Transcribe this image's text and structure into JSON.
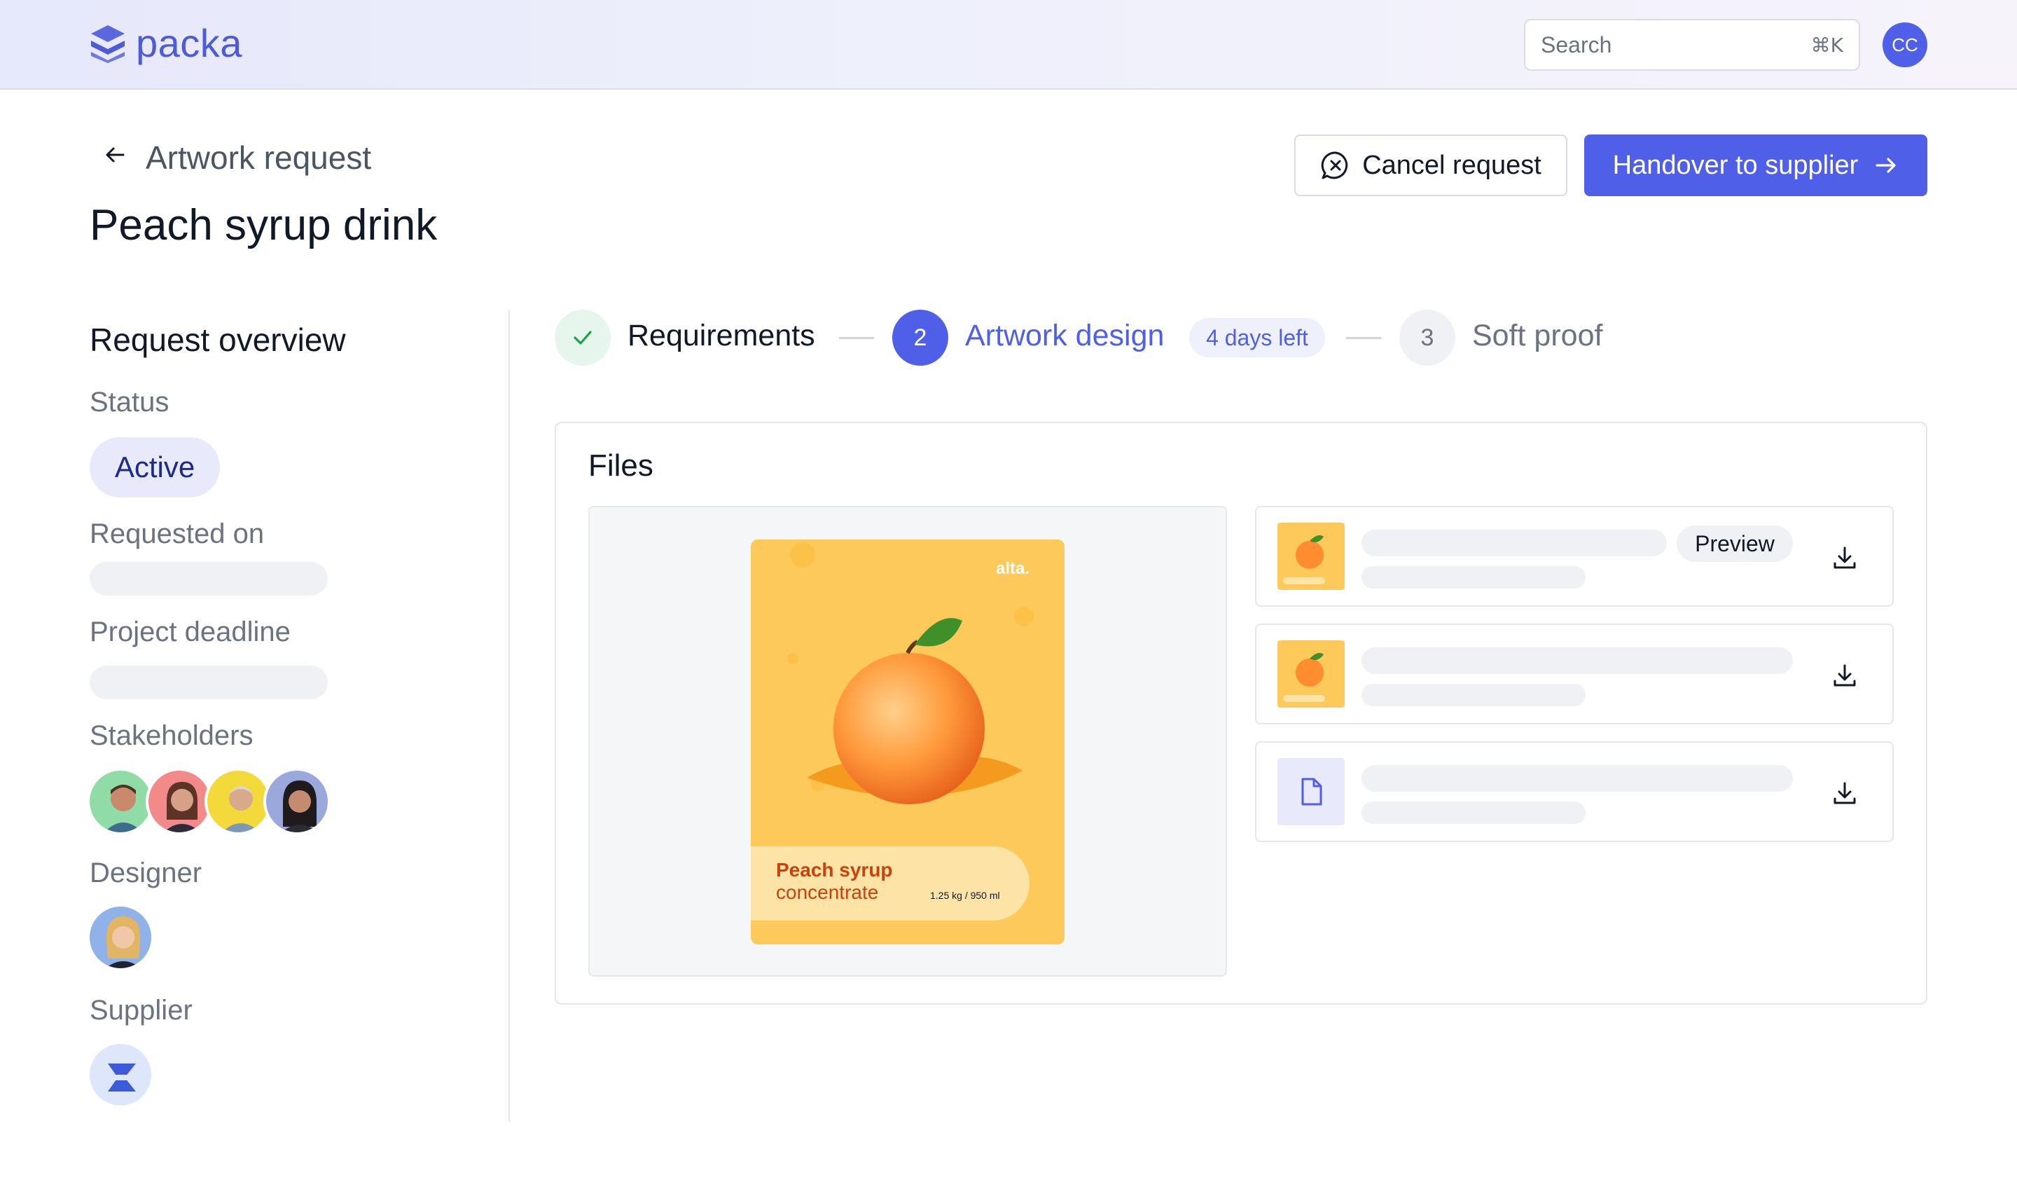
{
  "app": {
    "name": "packa"
  },
  "header": {
    "search_placeholder": "Search",
    "search_shortcut": "⌘K",
    "user_initials": "CC"
  },
  "page": {
    "breadcrumb": "Artwork request",
    "title": "Peach syrup drink",
    "cancel_label": "Cancel request",
    "handover_label": "Handover to supplier"
  },
  "overview": {
    "title": "Request overview",
    "status_label": "Status",
    "status_value": "Active",
    "requested_on_label": "Requested on",
    "deadline_label": "Project deadline",
    "stakeholders_label": "Stakeholders",
    "designer_label": "Designer",
    "supplier_label": "Supplier"
  },
  "stepper": {
    "step1": "Requirements",
    "step2_number": "2",
    "step2": "Artwork design",
    "step2_badge": "4 days left",
    "step3_number": "3",
    "step3": "Soft proof"
  },
  "files": {
    "title": "Files",
    "preview_label": "Preview"
  },
  "artwork": {
    "brand": "alta.",
    "product_line1": "Peach syrup",
    "product_line2": "concentrate",
    "volume": "1.25 kg / 950 ml"
  },
  "colors": {
    "accent": "#4f5fe8",
    "success": "#16a34a",
    "artwork_bg": "#fdc95a"
  }
}
